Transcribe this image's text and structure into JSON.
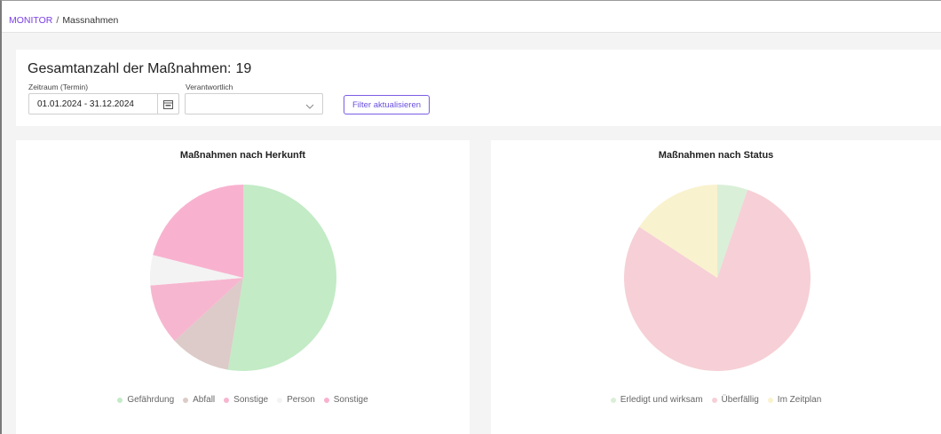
{
  "breadcrumb": {
    "root": "MONITOR",
    "separator": "/",
    "current": "Massnahmen"
  },
  "filter": {
    "title": "Gesamtanzahl der Maßnahmen:",
    "count": "19",
    "date_label": "Zeitraum (Termin)",
    "date_value": "01.01.2024 - 31.12.2024",
    "owner_label": "Verantwortlich",
    "owner_value": "",
    "button_label": "Filter aktualisieren"
  },
  "colors": {
    "accent": "#7b3fe4",
    "button": "#6a4fe0"
  },
  "chart_data": [
    {
      "type": "pie",
      "title": "Maßnahmen nach Herkunft",
      "series": [
        {
          "name": "Gefährdung",
          "value": 10,
          "color": "#c3ebc6"
        },
        {
          "name": "Abfall",
          "value": 2,
          "color": "#dccbc8"
        },
        {
          "name": "Sonstige",
          "value": 2,
          "color": "#f7b6cf"
        },
        {
          "name": "Person",
          "value": 1,
          "color": "#f3f3f3"
        },
        {
          "name": "Sonstige",
          "value": 4,
          "color": "#f8b2cf"
        }
      ]
    },
    {
      "type": "pie",
      "title": "Maßnahmen nach Status",
      "series": [
        {
          "name": "Erledigt und wirksam",
          "value": 1,
          "color": "#daefd7"
        },
        {
          "name": "Überfällig",
          "value": 15,
          "color": "#f6d0d6"
        },
        {
          "name": "Im Zeitplan",
          "value": 3,
          "color": "#f9f2ce"
        }
      ]
    }
  ]
}
